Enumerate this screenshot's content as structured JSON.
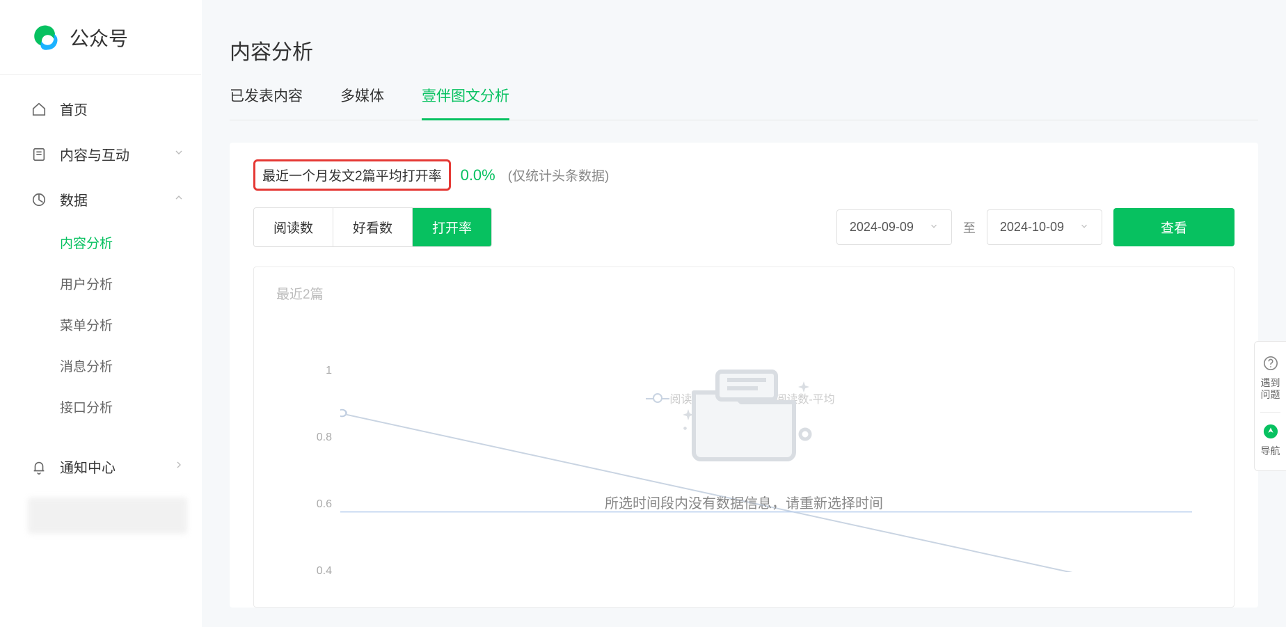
{
  "brand": {
    "name": "公众号"
  },
  "sidebar": {
    "home": "首页",
    "content": "内容与互动",
    "data": "数据",
    "subitems": {
      "content_analysis": "内容分析",
      "user_analysis": "用户分析",
      "menu_analysis": "菜单分析",
      "message_analysis": "消息分析",
      "api_analysis": "接口分析"
    },
    "notify": "通知中心"
  },
  "page": {
    "title": "内容分析",
    "tabs": {
      "published": "已发表内容",
      "multimedia": "多媒体",
      "yiban": "壹伴图文分析"
    }
  },
  "stat": {
    "highlight": "最近一个月发文2篇平均打开率",
    "percent": "0.0%",
    "note": "(仅统计头条数据)"
  },
  "metrics": {
    "reads": "阅读数",
    "likes": "好看数",
    "open_rate": "打开率"
  },
  "date": {
    "from": "2024-09-09",
    "to": "2024-10-09",
    "sep": "至",
    "view": "查看"
  },
  "chart": {
    "title": "最近2篇",
    "legend1": "阅读数",
    "legend2": "阅读数-平均",
    "empty": "所选时间段内没有数据信息，请重新选择时间"
  },
  "help": {
    "q_label": "遇到问题",
    "nav_label": "导航"
  },
  "chart_data": {
    "type": "line",
    "title": "最近2篇",
    "xlabel": "",
    "ylabel": "",
    "ylim": [
      0,
      1
    ],
    "y_ticks": [
      "1",
      "0.8",
      "0.6",
      "0.4"
    ],
    "series": [
      {
        "name": "阅读数",
        "values": []
      },
      {
        "name": "阅读数-平均",
        "values": []
      }
    ],
    "note": "所选时间段内没有数据信息，请重新选择时间"
  },
  "colors": {
    "accent": "#07c160",
    "highlight_border": "#e53935"
  }
}
